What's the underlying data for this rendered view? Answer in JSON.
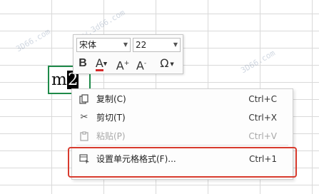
{
  "watermarks": [
    "3D66.com",
    "www.3d66.com",
    "3D66.com",
    "3D66.com"
  ],
  "cell": {
    "text_before": "m",
    "selected_text": "2"
  },
  "mini_toolbar": {
    "font_name": "宋体",
    "font_size": "22",
    "bold_label": "B",
    "font_color_label": "A",
    "increase_font_label": "A",
    "increase_font_sup": "+",
    "decrease_font_label": "A",
    "decrease_font_sup": "-",
    "symbol_label": "Ω",
    "colors": {
      "font_color_bar": "#d62b2b"
    }
  },
  "context_menu": {
    "items": [
      {
        "label": "复制(C)",
        "shortcut": "Ctrl+C",
        "icon": "copy-icon",
        "enabled": true
      },
      {
        "label": "剪切(T)",
        "shortcut": "Ctrl+X",
        "icon": "scissors-icon",
        "enabled": true
      },
      {
        "label": "粘贴(P)",
        "shortcut": "Ctrl+V",
        "icon": "paste-icon",
        "enabled": false
      },
      {
        "label": "设置单元格格式(F)...",
        "shortcut": "Ctrl+1",
        "icon": "format-cells-icon",
        "enabled": true
      }
    ]
  },
  "colors": {
    "grid": "#d9d9d9",
    "cell_border": "#1e8a49",
    "highlight": "#d83b2e"
  }
}
